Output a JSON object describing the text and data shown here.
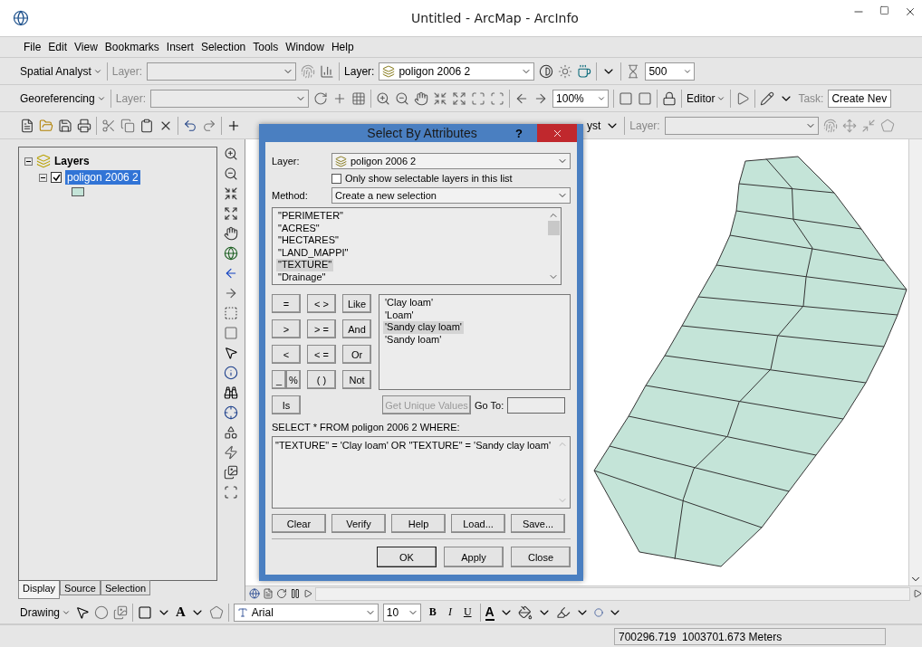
{
  "window": {
    "title": "Untitled - ArcMap - ArcInfo"
  },
  "menu": [
    "File",
    "Edit",
    "View",
    "Bookmarks",
    "Insert",
    "Selection",
    "Tools",
    "Window",
    "Help"
  ],
  "spatial_analyst_toolbar": {
    "label": "Spatial Analyst",
    "layer_label": "Layer:"
  },
  "layer_toolbar": {
    "layer_label": "Layer:",
    "layer_value": "poligon 2006 2",
    "threshold": "500"
  },
  "georeferencing_toolbar": {
    "label": "Georeferencing",
    "layer_label": "Layer:",
    "zoom": "100%"
  },
  "editor_toolbar": {
    "label": "Editor",
    "task_label": "Task:",
    "task_value": "Create Nev"
  },
  "standard_toolbar": {
    "cut_label": "yst",
    "layer_label": "Layer:"
  },
  "toc": {
    "root": "Layers",
    "root_expanded": true,
    "layers": [
      {
        "name": "poligon 2006 2",
        "checked": true,
        "selected": true,
        "expanded": true
      }
    ]
  },
  "toc_tabs": [
    {
      "label": "Display",
      "selected": true
    },
    {
      "label": "Source",
      "selected": false
    },
    {
      "label": "Selection",
      "selected": false
    }
  ],
  "dialog": {
    "title": "Select By Attributes",
    "help": "?",
    "layer_label": "Layer:",
    "layer_value": "poligon 2006 2",
    "only_selectable": {
      "label": "Only show selectable layers in this list",
      "checked": false
    },
    "method_label": "Method:",
    "method_value": "Create a new selection",
    "fields": [
      {
        "label": "\"PERIMETER\"",
        "selected": false
      },
      {
        "label": "\"ACRES\"",
        "selected": false
      },
      {
        "label": "\"HECTARES\"",
        "selected": false
      },
      {
        "label": "\"LAND_MAPPI\"",
        "selected": false
      },
      {
        "label": "\"TEXTURE\"",
        "selected": true
      },
      {
        "label": "\"Drainage\"",
        "selected": false
      }
    ],
    "operators": [
      "=",
      "< >",
      "Like",
      ">",
      "> =",
      "And",
      "<",
      "< =",
      "Or",
      "_",
      "%",
      "( )",
      "Not",
      "Is"
    ],
    "values": [
      {
        "label": "'Clay loam'",
        "selected": false
      },
      {
        "label": "'Loam'",
        "selected": false
      },
      {
        "label": "'Sandy clay loam'",
        "selected": true
      },
      {
        "label": "'Sandy loam'",
        "selected": false
      }
    ],
    "unique_values": {
      "label": "Get Unique Values",
      "disabled": true
    },
    "goto_label": "Go To:",
    "sql_label": "SELECT * FROM poligon 2006 2 WHERE:",
    "expression": "\"TEXTURE\" = 'Clay loam' OR \"TEXTURE\" = 'Sandy clay loam'",
    "buttons": [
      "Clear",
      "Verify",
      "Help",
      "Load...",
      "Save..."
    ],
    "footer_buttons": [
      {
        "label": "OK",
        "default": true
      },
      {
        "label": "Apply",
        "default": false
      },
      {
        "label": "Close",
        "default": false
      }
    ]
  },
  "drawing_toolbar": {
    "label": "Drawing",
    "text_tool": "A",
    "font": "Arial",
    "size": "10",
    "bold": "B",
    "italic": "I",
    "underline": "U",
    "font_color": "A"
  },
  "status_bar": {
    "coordinates": "700296.719  1003701.673 Meters"
  }
}
